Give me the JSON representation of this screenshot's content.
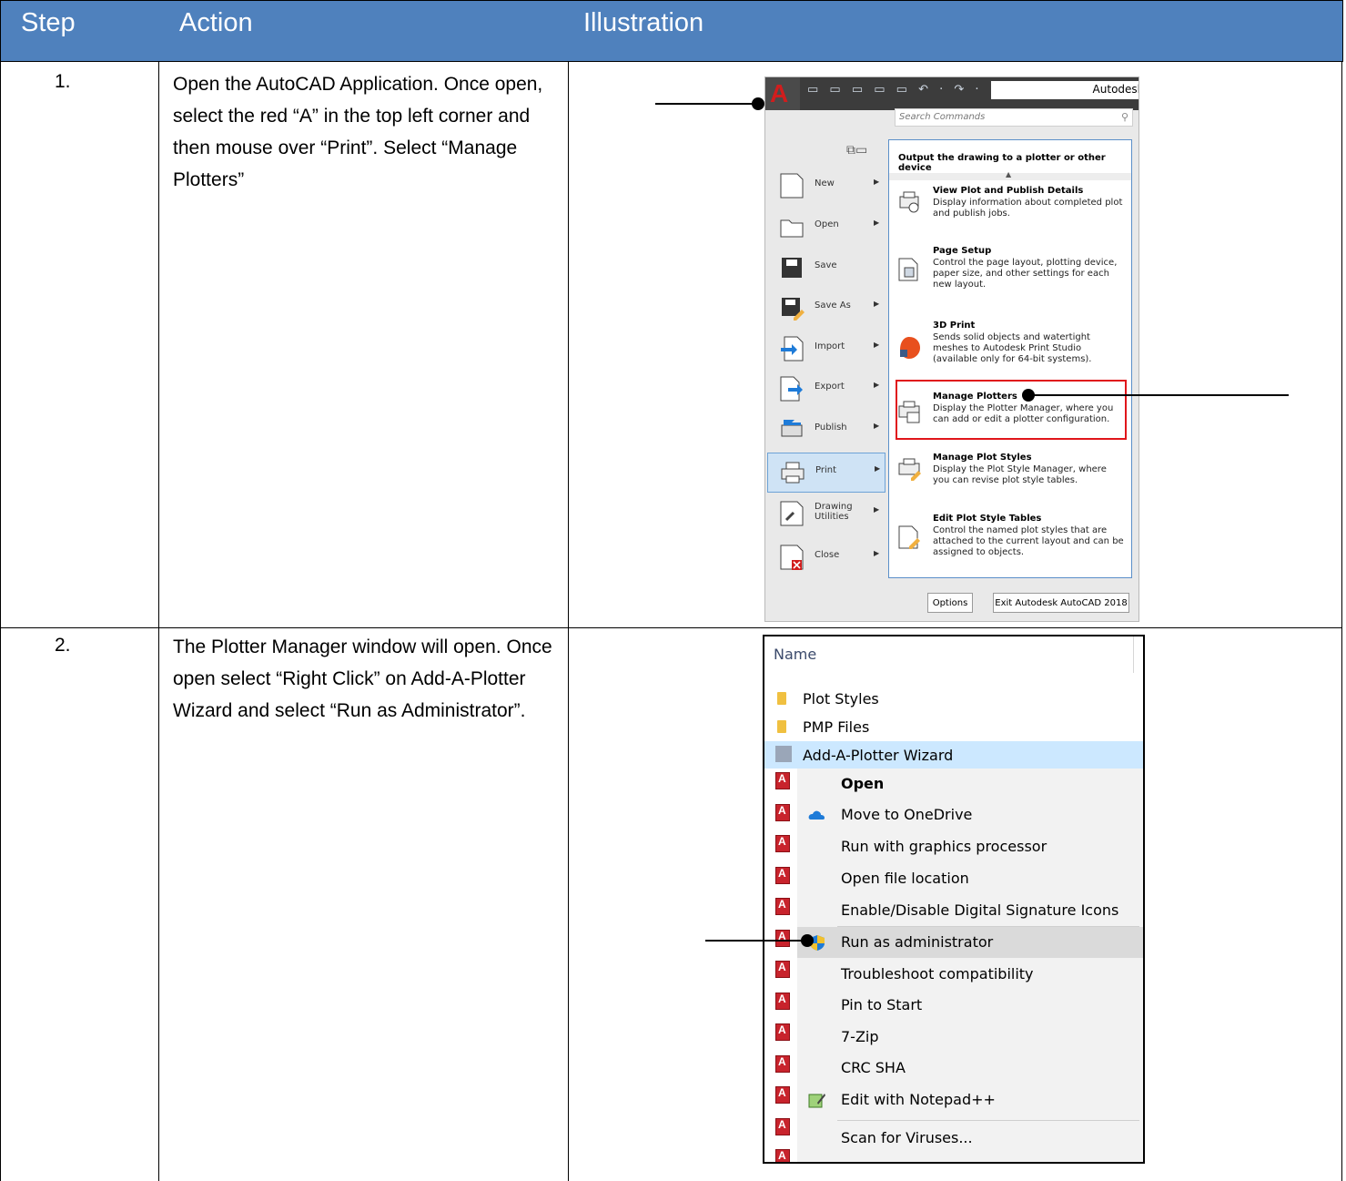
{
  "table": {
    "headers": [
      "Step",
      "Action",
      "Illustration"
    ],
    "rows": [
      {
        "step": "1.",
        "action": "Open the AutoCAD Application. Once open, select the red “A” in the top left corner and then mouse over “Print”. Select “Manage Plotters”"
      },
      {
        "step": "2.",
        "action": "The Plotter Manager window will open. Once open select “Right Click” on Add-A-Plotter Wizard and select “Run as Administrator”."
      }
    ]
  },
  "autocad": {
    "logo_letter": "A",
    "title_fragment": "Autodesl",
    "search_placeholder": "Search Commands",
    "menu_items": [
      "New",
      "Open",
      "Save",
      "Save As",
      "Import",
      "Export",
      "Publish",
      "Print",
      "Drawing Utilities",
      "Close"
    ],
    "active_item": "Print",
    "submenu_heading": "Output the drawing to a plotter or other device",
    "submenu_items": [
      {
        "title": "View Plot and Publish Details",
        "desc": "Display information about completed plot and publish jobs."
      },
      {
        "title": "Page Setup",
        "desc": "Control the page layout, plotting device, paper size, and other settings for each new layout."
      },
      {
        "title": "3D Print",
        "desc": "Sends solid objects and watertight meshes to Autodesk Print Studio (available only for 64-bit systems)."
      },
      {
        "title": "Manage Plotters",
        "desc": "Display the Plotter Manager, where you can add or edit a plotter configuration."
      },
      {
        "title": "Manage Plot Styles",
        "desc": "Display the Plot Style Manager, where you can revise plot style tables."
      },
      {
        "title": "Edit Plot Style Tables",
        "desc": "Control the named plot styles that are attached to the current layout and can be assigned to objects."
      }
    ],
    "options_button": "Options",
    "exit_button": "Exit Autodesk AutoCAD 2018"
  },
  "explorer": {
    "column_header": "Name",
    "files": [
      {
        "name": "Plot Styles",
        "icon": "folder-icon"
      },
      {
        "name": "PMP Files",
        "icon": "folder-icon"
      },
      {
        "name": "Add-A-Plotter Wizard",
        "icon": "wizard-icon"
      }
    ],
    "context_menu": [
      {
        "label": "Open",
        "icon": ""
      },
      {
        "label": "Move to OneDrive",
        "icon": "onedrive-icon"
      },
      {
        "label": "Run with graphics processor",
        "icon": ""
      },
      {
        "label": "Open file location",
        "icon": ""
      },
      {
        "label": "Enable/Disable Digital Signature Icons",
        "icon": ""
      },
      {
        "label": "Run as administrator",
        "icon": "uac-shield-icon"
      },
      {
        "label": "Troubleshoot compatibility",
        "icon": ""
      },
      {
        "label": "Pin to Start",
        "icon": ""
      },
      {
        "label": "7-Zip",
        "icon": ""
      },
      {
        "label": "CRC SHA",
        "icon": ""
      },
      {
        "label": "Edit with Notepad++",
        "icon": "notepad-plus-icon"
      },
      {
        "label": "Scan for Viruses...",
        "icon": ""
      }
    ]
  },
  "colors": {
    "header_bg": "#4f81bd",
    "highlight_red": "#e0161b",
    "autocad_red": "#d11d1d"
  }
}
